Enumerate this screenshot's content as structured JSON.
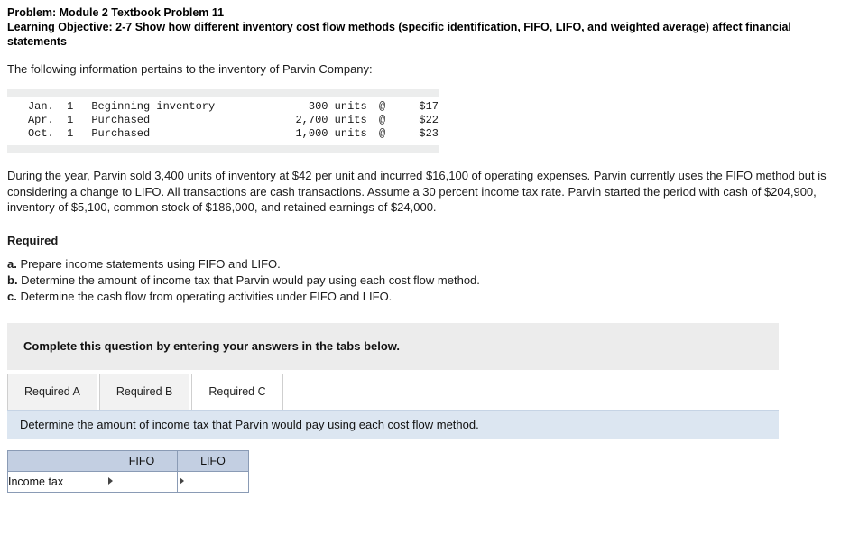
{
  "header": {
    "problem_title": "Problem: Module 2 Textbook Problem 11",
    "objective": "Learning Objective: 2-7 Show how different inventory cost flow methods (specific identification, FIFO, LIFO, and weighted average) affect financial statements"
  },
  "intro": "The following information pertains to the inventory of Parvin Company:",
  "inventory_table": {
    "rows": [
      {
        "date": "Jan.  1",
        "description": "Beginning inventory",
        "units": "300 units",
        "at": "@",
        "price": "$17"
      },
      {
        "date": "Apr.  1",
        "description": "Purchased",
        "units": "2,700 units",
        "at": "@",
        "price": "$22"
      },
      {
        "date": "Oct.  1",
        "description": "Purchased",
        "units": "1,000 units",
        "at": "@",
        "price": "$23"
      }
    ]
  },
  "body_paragraph": "During the year, Parvin sold 3,400 units of inventory at $42 per unit and incurred $16,100 of operating expenses. Parvin currently uses the FIFO method but is considering a change to LIFO. All transactions are cash transactions. Assume a 30 percent income tax rate. Parvin started the period with cash of $204,900, inventory of $5,100, common stock of $186,000, and retained earnings of $24,000.",
  "required": {
    "heading": "Required",
    "items": [
      {
        "letter": "a.",
        "text": " Prepare income statements using FIFO and LIFO."
      },
      {
        "letter": "b.",
        "text": " Determine the amount of income tax that Parvin would pay using each cost flow method."
      },
      {
        "letter": "c.",
        "text": " Determine the cash flow from operating activities under FIFO and LIFO."
      }
    ]
  },
  "complete_bar": "Complete this question by entering your answers in the tabs below.",
  "tabs": [
    {
      "label": "Required A",
      "active": false
    },
    {
      "label": "Required B",
      "active": false
    },
    {
      "label": "Required C",
      "active": true
    }
  ],
  "prompt": "Determine the amount of income tax that Parvin would pay using each cost flow method.",
  "answer_table": {
    "headers": [
      "",
      "FIFO",
      "LIFO"
    ],
    "rows": [
      {
        "label": "Income tax",
        "fifo": "",
        "lifo": ""
      }
    ]
  }
}
